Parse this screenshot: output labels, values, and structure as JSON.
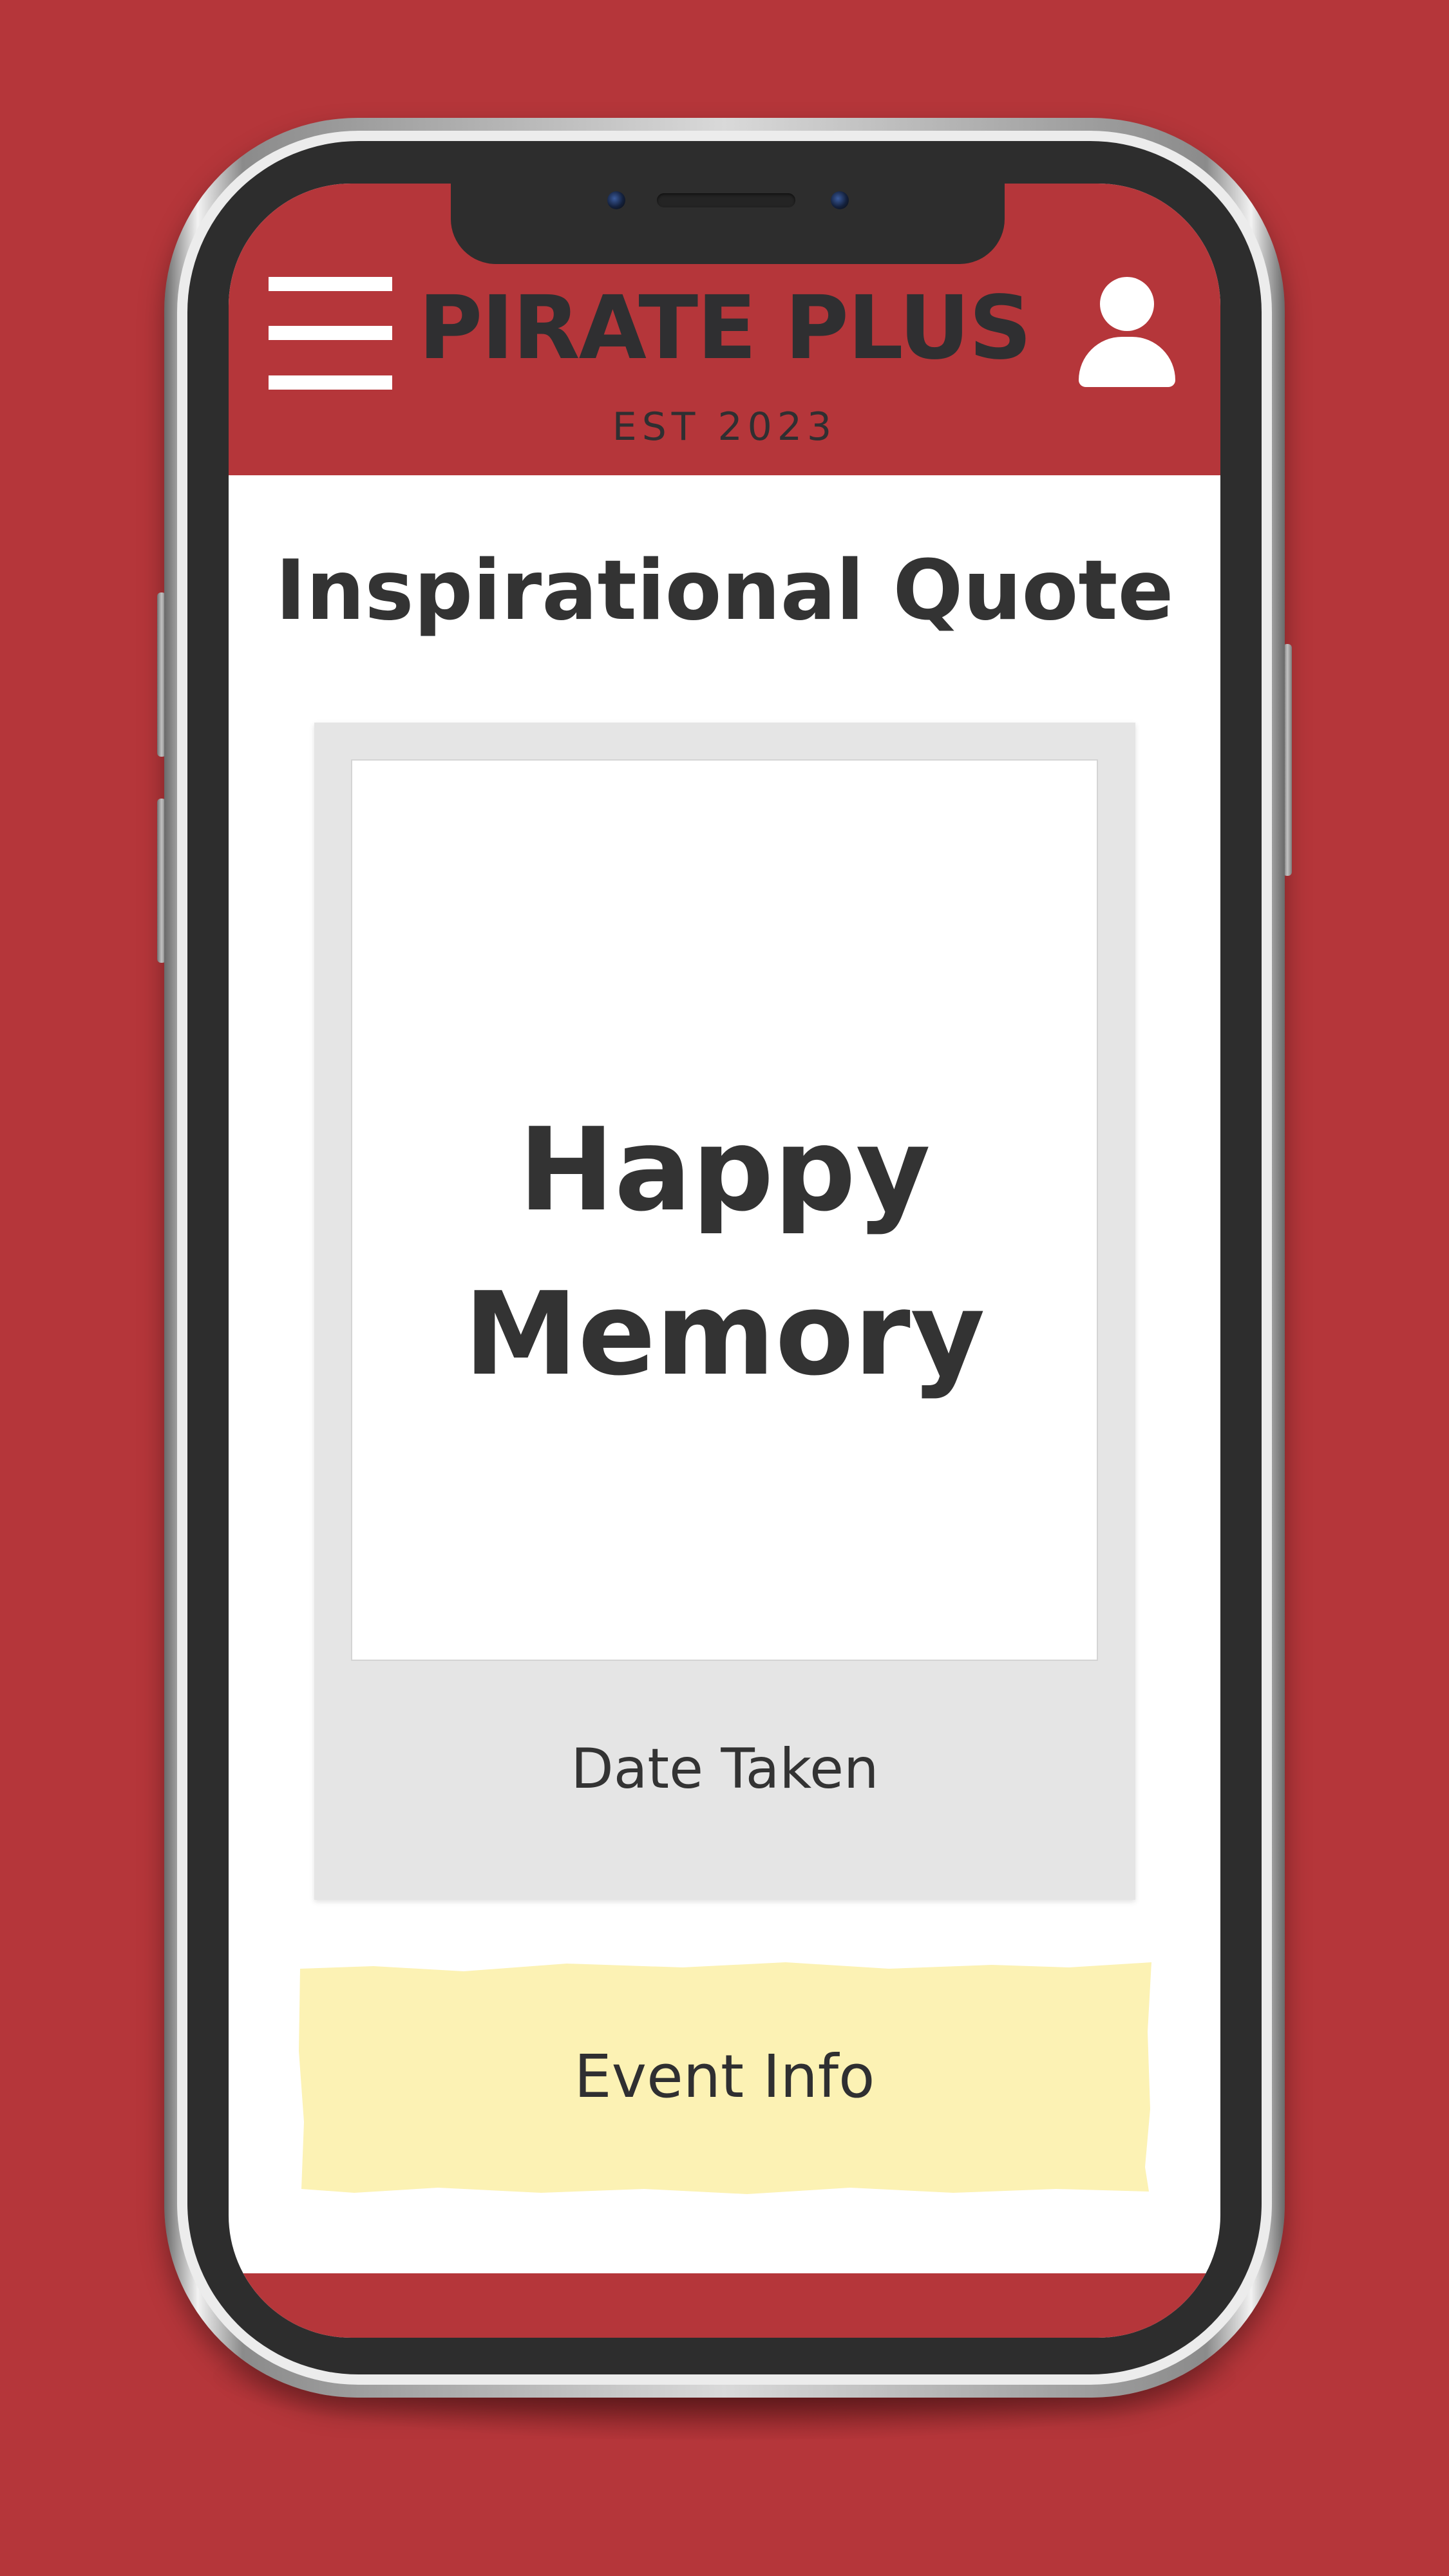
{
  "colors": {
    "brand_red": "#b5363a",
    "text_dark": "#333333",
    "polaroid_gray": "#e5e5e5",
    "highlight_yellow": "#fcf2b4"
  },
  "header": {
    "brand_name": "PIRATE PLUS",
    "tagline": "EST 2023",
    "menu_icon": "hamburger-menu-icon",
    "profile_icon": "user-profile-icon"
  },
  "main": {
    "title": "Inspirational Quote",
    "polaroid": {
      "photo_text_line1": "Happy",
      "photo_text_line2": "Memory",
      "date_label": "Date Taken"
    },
    "event_button_label": "Event Info"
  }
}
